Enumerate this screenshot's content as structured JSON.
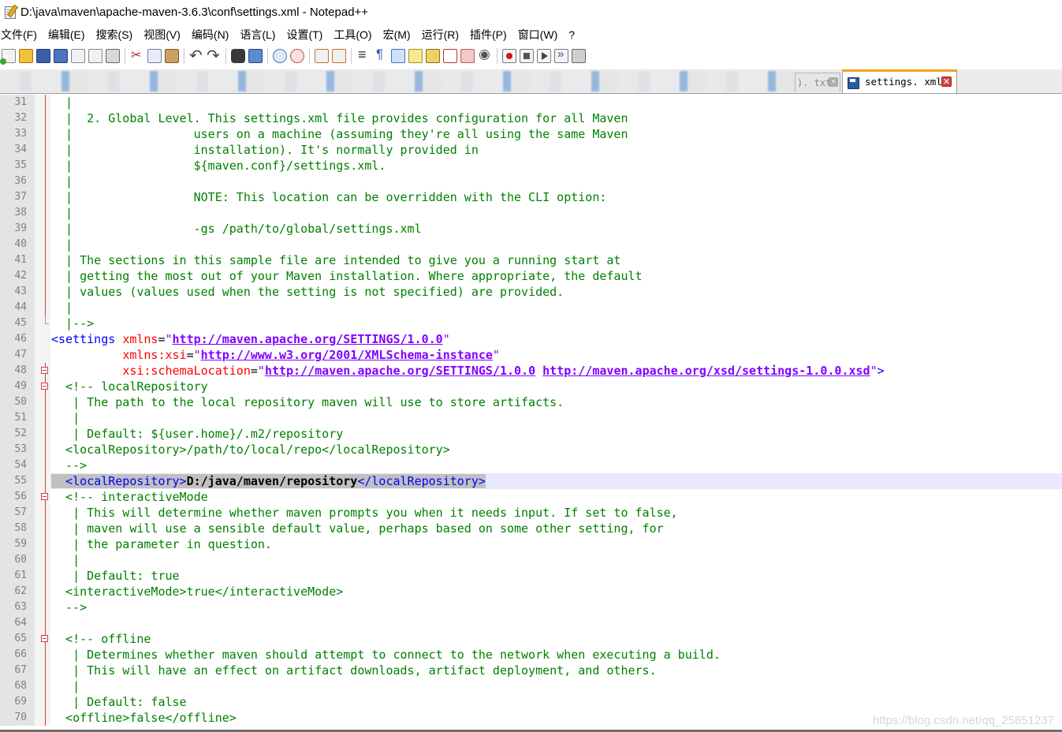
{
  "window": {
    "title": "D:\\java\\maven\\apache-maven-3.6.3\\conf\\settings.xml - Notepad++"
  },
  "menu": [
    "文件(F)",
    "编辑(E)",
    "搜索(S)",
    "视图(V)",
    "编码(N)",
    "语言(L)",
    "设置(T)",
    "工具(O)",
    "宏(M)",
    "运行(R)",
    "插件(P)",
    "窗口(W)",
    "?"
  ],
  "tabs": {
    "partial_label": "). txt",
    "active_label": "settings. xml",
    "close_glyph": "✕"
  },
  "editor": {
    "lines": [
      {
        "n": "31",
        "fold": "v",
        "segs": [
          [
            "comment",
            "  |"
          ]
        ]
      },
      {
        "n": "32",
        "fold": "v",
        "segs": [
          [
            "comment",
            "  |  2. Global Level. This settings.xml file provides configuration for all Maven"
          ]
        ]
      },
      {
        "n": "33",
        "fold": "v",
        "segs": [
          [
            "comment",
            "  |                 users on a machine (assuming they're all using the same Maven"
          ]
        ]
      },
      {
        "n": "34",
        "fold": "v",
        "segs": [
          [
            "comment",
            "  |                 installation). It's normally provided in"
          ]
        ]
      },
      {
        "n": "35",
        "fold": "v",
        "segs": [
          [
            "comment",
            "  |                 ${maven.conf}/settings.xml."
          ]
        ]
      },
      {
        "n": "36",
        "fold": "v",
        "segs": [
          [
            "comment",
            "  |"
          ]
        ]
      },
      {
        "n": "37",
        "fold": "v",
        "segs": [
          [
            "comment",
            "  |                 NOTE: This location can be overridden with the CLI option:"
          ]
        ]
      },
      {
        "n": "38",
        "fold": "v",
        "segs": [
          [
            "comment",
            "  |"
          ]
        ]
      },
      {
        "n": "39",
        "fold": "v",
        "segs": [
          [
            "comment",
            "  |                 -gs /path/to/global/settings.xml"
          ]
        ]
      },
      {
        "n": "40",
        "fold": "v",
        "segs": [
          [
            "comment",
            "  |"
          ]
        ]
      },
      {
        "n": "41",
        "fold": "v",
        "segs": [
          [
            "comment",
            "  | The sections in this sample file are intended to give you a running start at"
          ]
        ]
      },
      {
        "n": "42",
        "fold": "v",
        "segs": [
          [
            "comment",
            "  | getting the most out of your Maven installation. Where appropriate, the default"
          ]
        ]
      },
      {
        "n": "43",
        "fold": "v",
        "segs": [
          [
            "comment",
            "  | values (values used when the setting is not specified) are provided."
          ]
        ]
      },
      {
        "n": "44",
        "fold": "v",
        "segs": [
          [
            "comment",
            "  |"
          ]
        ]
      },
      {
        "n": "45",
        "fold": "end",
        "segs": [
          [
            "comment",
            "  |-->"
          ]
        ]
      },
      {
        "n": "46",
        "fold": "none",
        "segs": [
          [
            "tag",
            "<settings "
          ],
          [
            "attr",
            "xmlns"
          ],
          [
            "eq",
            "="
          ],
          [
            "q",
            "\""
          ],
          [
            "url",
            "http://maven.apache.org/SETTINGS/1.0.0"
          ],
          [
            "q",
            "\""
          ]
        ]
      },
      {
        "n": "47",
        "fold": "none",
        "segs": [
          [
            "text",
            "          "
          ],
          [
            "attr",
            "xmlns:xsi"
          ],
          [
            "eq",
            "="
          ],
          [
            "q",
            "\""
          ],
          [
            "url",
            "http://www.w3.org/2001/XMLSchema-instance"
          ],
          [
            "q",
            "\""
          ]
        ]
      },
      {
        "n": "48",
        "fold": "box",
        "segs": [
          [
            "text",
            "          "
          ],
          [
            "attr",
            "xsi:schemaLocation"
          ],
          [
            "eq",
            "="
          ],
          [
            "q",
            "\""
          ],
          [
            "url",
            "http://maven.apache.org/SETTINGS/1.0.0"
          ],
          [
            "text",
            " "
          ],
          [
            "url",
            "http://maven.apache.org/xsd/settings-1.0.0.xsd"
          ],
          [
            "q",
            "\""
          ],
          [
            "tag",
            ">"
          ]
        ]
      },
      {
        "n": "49",
        "fold": "box",
        "segs": [
          [
            "comment",
            "  <!-- localRepository"
          ]
        ]
      },
      {
        "n": "50",
        "fold": "v",
        "segs": [
          [
            "comment",
            "   | The path to the local repository maven will use to store artifacts."
          ]
        ]
      },
      {
        "n": "51",
        "fold": "v",
        "segs": [
          [
            "comment",
            "   |"
          ]
        ]
      },
      {
        "n": "52",
        "fold": "v",
        "segs": [
          [
            "comment",
            "   | Default: ${user.home}/.m2/repository"
          ]
        ]
      },
      {
        "n": "53",
        "fold": "v",
        "segs": [
          [
            "comment",
            "  <localRepository>/path/to/local/repo</localRepository>"
          ]
        ]
      },
      {
        "n": "54",
        "fold": "v",
        "segs": [
          [
            "comment",
            "  -->"
          ]
        ]
      },
      {
        "n": "55",
        "fold": "v",
        "current": true,
        "segs": [
          [
            "hltext",
            "  "
          ],
          [
            "hltag",
            "<localRepository>"
          ],
          [
            "hlbold",
            "D:/java/maven/repository"
          ],
          [
            "hltag",
            "</localRepository>"
          ]
        ]
      },
      {
        "n": "56",
        "fold": "box",
        "segs": [
          [
            "comment",
            "  <!-- interactiveMode"
          ]
        ]
      },
      {
        "n": "57",
        "fold": "v",
        "segs": [
          [
            "comment",
            "   | This will determine whether maven prompts you when it needs input. If set to false,"
          ]
        ]
      },
      {
        "n": "58",
        "fold": "v",
        "segs": [
          [
            "comment",
            "   | maven will use a sensible default value, perhaps based on some other setting, for"
          ]
        ]
      },
      {
        "n": "59",
        "fold": "v",
        "segs": [
          [
            "comment",
            "   | the parameter in question."
          ]
        ]
      },
      {
        "n": "60",
        "fold": "v",
        "segs": [
          [
            "comment",
            "   |"
          ]
        ]
      },
      {
        "n": "61",
        "fold": "v",
        "segs": [
          [
            "comment",
            "   | Default: true"
          ]
        ]
      },
      {
        "n": "62",
        "fold": "v",
        "segs": [
          [
            "comment",
            "  <interactiveMode>true</interactiveMode>"
          ]
        ]
      },
      {
        "n": "63",
        "fold": "v",
        "segs": [
          [
            "comment",
            "  -->"
          ]
        ]
      },
      {
        "n": "64",
        "fold": "v",
        "segs": [
          [
            "text",
            ""
          ]
        ]
      },
      {
        "n": "65",
        "fold": "box",
        "segs": [
          [
            "comment",
            "  <!-- offline"
          ]
        ]
      },
      {
        "n": "66",
        "fold": "v",
        "segs": [
          [
            "comment",
            "   | Determines whether maven should attempt to connect to the network when executing a build."
          ]
        ]
      },
      {
        "n": "67",
        "fold": "v",
        "segs": [
          [
            "comment",
            "   | This will have an effect on artifact downloads, artifact deployment, and others."
          ]
        ]
      },
      {
        "n": "68",
        "fold": "v",
        "segs": [
          [
            "comment",
            "   |"
          ]
        ]
      },
      {
        "n": "69",
        "fold": "v",
        "segs": [
          [
            "comment",
            "   | Default: false"
          ]
        ]
      },
      {
        "n": "70",
        "fold": "v",
        "segs": [
          [
            "comment",
            "  <offline>false</offline>"
          ]
        ]
      }
    ]
  },
  "watermark": "https://blog.csdn.net/qq_25851237"
}
